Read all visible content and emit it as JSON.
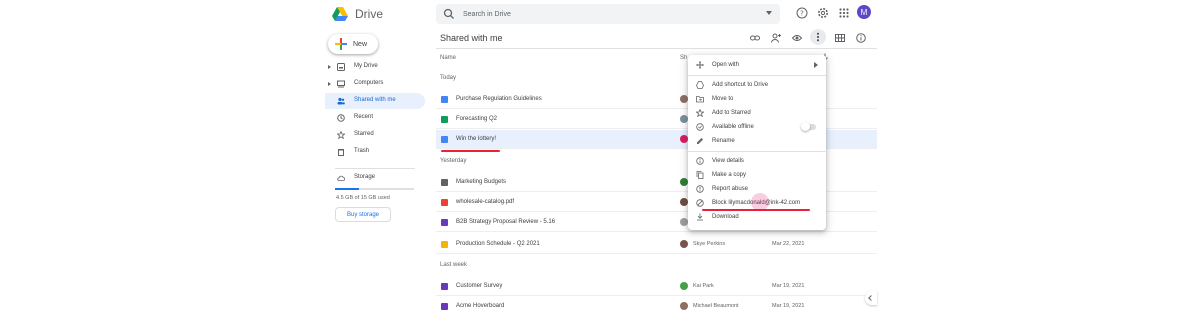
{
  "app": {
    "brand": "Drive"
  },
  "search": {
    "placeholder": "Search in Drive"
  },
  "topbar": {
    "avatar_initial": "M"
  },
  "sidebar": {
    "new_label": "New",
    "items": [
      {
        "label": "My Drive",
        "icon": "my-drive-icon"
      },
      {
        "label": "Computers",
        "icon": "computer-icon"
      },
      {
        "label": "Shared with me",
        "icon": "shared-icon",
        "active": true
      },
      {
        "label": "Recent",
        "icon": "clock-icon"
      },
      {
        "label": "Starred",
        "icon": "star-icon"
      },
      {
        "label": "Trash",
        "icon": "trash-icon"
      }
    ],
    "storage": {
      "label": "Storage",
      "usage": "4.5 GB of 15 GB used",
      "fill_fraction": 0.3,
      "buy_label": "Buy storage"
    }
  },
  "main": {
    "title": "Shared with me",
    "columns": {
      "name": "Name",
      "owner": "Sh"
    },
    "sections": [
      {
        "label": "Today",
        "rows": [
          {
            "name": "Purchase Regulation Guidelines",
            "type": "doc",
            "owner": "",
            "date": ""
          },
          {
            "name": "Forecasting Q2",
            "type": "sheet",
            "owner": "",
            "date": ""
          },
          {
            "name": "Win the lottery!",
            "type": "doc",
            "owner": "",
            "date": "",
            "selected": true
          }
        ]
      },
      {
        "label": "Yesterday",
        "rows": [
          {
            "name": "Marketing Budgets",
            "type": "folder",
            "owner": "",
            "date": ""
          },
          {
            "name": "wholesale-catalog.pdf",
            "type": "pdf",
            "owner": "",
            "date": ""
          },
          {
            "name": "B2B Strategy Proposal Review - 5.16",
            "type": "form",
            "owner": "",
            "date": ""
          },
          {
            "name": "Production Schedule - Q2 2021",
            "type": "slides",
            "owner": "Skye Perkins",
            "date": "Mar 22, 2021"
          }
        ]
      },
      {
        "label": "Last week",
        "rows": [
          {
            "name": "Customer Survey",
            "type": "form",
            "owner": "Kai Park",
            "date": "Mar 19, 2021"
          },
          {
            "name": "Acme Hoverboard",
            "type": "form",
            "owner": "Michael Beaumont",
            "date": "Mar 19, 2021"
          }
        ]
      }
    ]
  },
  "context_menu": {
    "items": [
      {
        "label": "Open with",
        "icon": "open-with-icon",
        "submenu": true
      },
      {
        "label": "Add shortcut to Drive",
        "icon": "add-shortcut-icon"
      },
      {
        "label": "Move to",
        "icon": "move-to-icon"
      },
      {
        "label": "Add to Starred",
        "icon": "star-icon"
      },
      {
        "label": "Available offline",
        "icon": "offline-icon",
        "toggle": true
      },
      {
        "label": "Rename",
        "icon": "rename-icon"
      },
      {
        "label": "View details",
        "icon": "info-icon"
      },
      {
        "label": "Make a copy",
        "icon": "copy-icon"
      },
      {
        "label": "Report abuse",
        "icon": "report-icon"
      },
      {
        "label": "Block lilymacdonald@ink-42.com",
        "icon": "block-icon"
      },
      {
        "label": "Download",
        "icon": "download-icon"
      }
    ]
  },
  "colors": {
    "accent": "#1a73e8",
    "selected_row": "#e8f0fe",
    "annotation_red": "#e8203a"
  }
}
